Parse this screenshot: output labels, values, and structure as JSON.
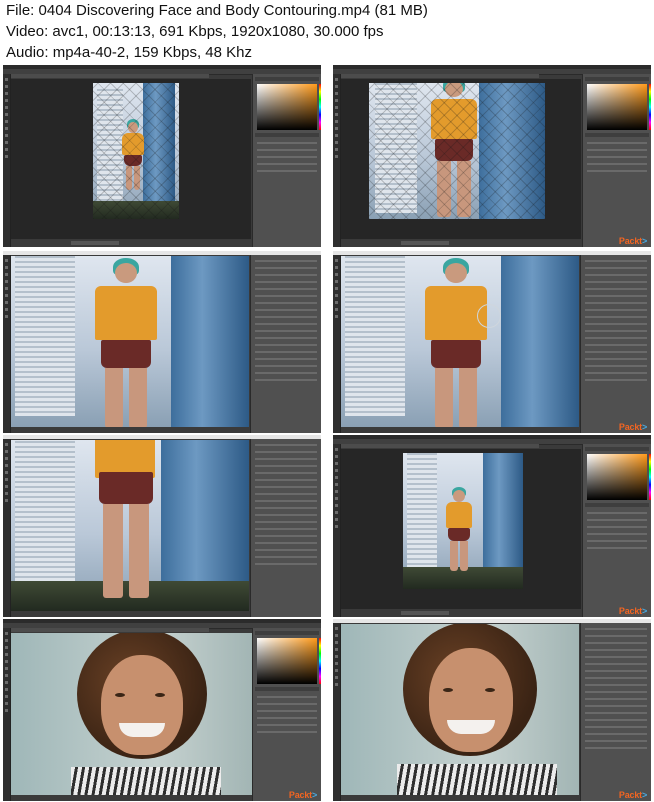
{
  "header": {
    "file_line": "File: 0404 Discovering Face and Body Contouring.mp4 (81 MB)",
    "video_line": "Video: avc1, 00:13:13, 691 Kbps, 1920x1080, 30.000 fps",
    "audio_line": "Audio: mp4a-40-2, 159 Kbps, 48 Khz"
  },
  "brand": {
    "name_part1": "Packt",
    "name_part2": ">"
  },
  "colors": {
    "app_bg": "#3a3a3a",
    "panel_bg": "#505050",
    "brand_orange": "#f26522",
    "brand_blue": "#49a8de"
  },
  "thumbnails": [
    {
      "id": "t1",
      "scene": "street-mesh-small"
    },
    {
      "id": "t2",
      "scene": "street-mesh-zoom"
    },
    {
      "id": "t3",
      "scene": "street-liquify"
    },
    {
      "id": "t4",
      "scene": "street-liquify-brush"
    },
    {
      "id": "t5",
      "scene": "street-legs"
    },
    {
      "id": "t6",
      "scene": "street-full"
    },
    {
      "id": "t7",
      "scene": "portrait-picker"
    },
    {
      "id": "t8",
      "scene": "portrait-liquify"
    }
  ]
}
